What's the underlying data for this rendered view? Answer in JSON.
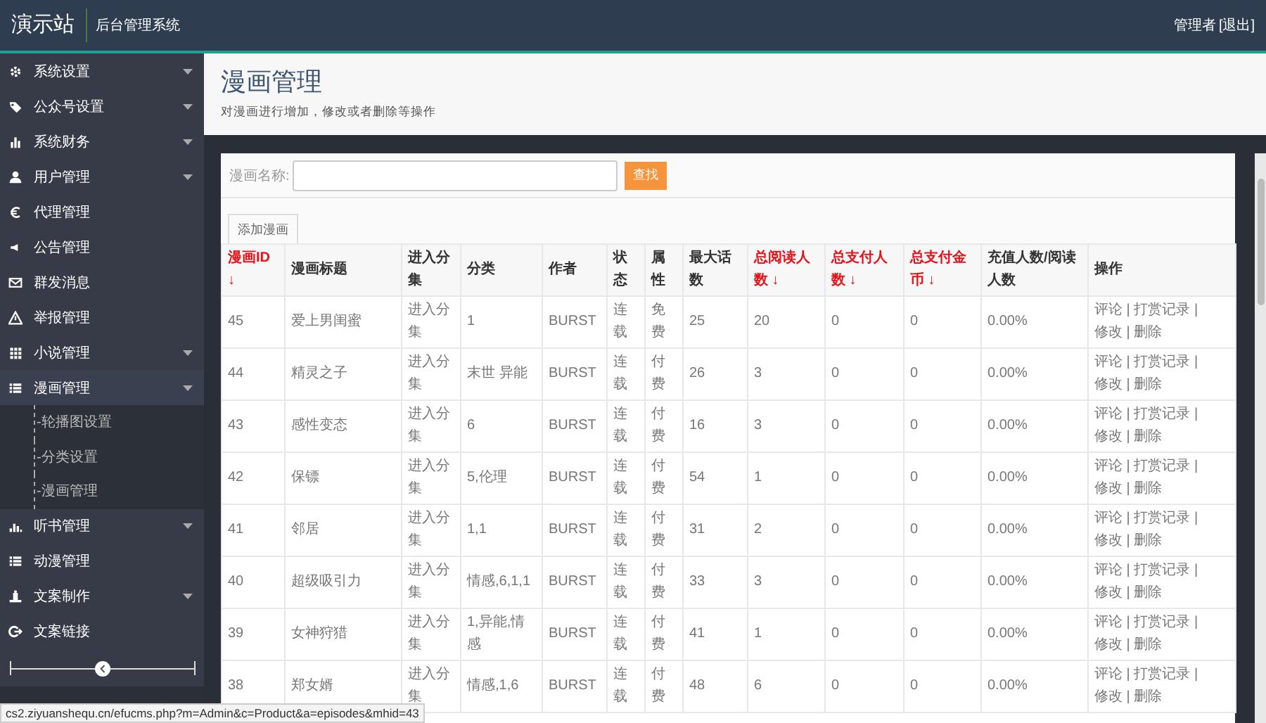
{
  "header": {
    "brand": "演示站",
    "system_name": "后台管理系统",
    "user": "管理者",
    "logout": "[退出]"
  },
  "sidebar": {
    "items": [
      {
        "label": "系统设置",
        "has_submenu": true,
        "expanded": false
      },
      {
        "label": "公众号设置",
        "has_submenu": true,
        "expanded": false
      },
      {
        "label": "系统财务",
        "has_submenu": true,
        "expanded": false
      },
      {
        "label": "用户管理",
        "has_submenu": true,
        "expanded": false
      },
      {
        "label": "代理管理",
        "has_submenu": false
      },
      {
        "label": "公告管理",
        "has_submenu": false
      },
      {
        "label": "群发消息",
        "has_submenu": false
      },
      {
        "label": "举报管理",
        "has_submenu": false
      },
      {
        "label": "小说管理",
        "has_submenu": true,
        "expanded": false
      },
      {
        "label": "漫画管理",
        "has_submenu": true,
        "expanded": true,
        "children": [
          {
            "label": "-轮播图设置"
          },
          {
            "label": "-分类设置"
          },
          {
            "label": "-漫画管理"
          }
        ]
      },
      {
        "label": "听书管理",
        "has_submenu": true,
        "expanded": false
      },
      {
        "label": "动漫管理",
        "has_submenu": false
      },
      {
        "label": "文案制作",
        "has_submenu": true,
        "expanded": false
      },
      {
        "label": "文案链接",
        "has_submenu": false
      }
    ],
    "collapse_slider": {
      "level": 0.5
    }
  },
  "page": {
    "title": "漫画管理",
    "subtitle": "对漫画进行增加，修改或者删除等操作"
  },
  "search": {
    "label": "漫画名称:",
    "button": "查找"
  },
  "add_button": "添加漫画",
  "table": {
    "action_separator": "|",
    "columns": [
      {
        "label": "漫画ID ↓",
        "sortable": true
      },
      {
        "label": "漫画标题",
        "sortable": false
      },
      {
        "label": "进入分集",
        "sortable": false
      },
      {
        "label": "分类",
        "sortable": false
      },
      {
        "label": "作者",
        "sortable": false
      },
      {
        "label": "状态",
        "sortable": false
      },
      {
        "label": "属性",
        "sortable": false
      },
      {
        "label": "最大话数",
        "sortable": false
      },
      {
        "label": "总阅读人数 ↓",
        "sortable": true
      },
      {
        "label": "总支付人数 ↓",
        "sortable": true
      },
      {
        "label": "总支付金币 ↓",
        "sortable": true
      },
      {
        "label": "充值人数/阅读人数",
        "sortable": false
      },
      {
        "label": "操作",
        "sortable": false
      }
    ],
    "rows": [
      {
        "id": "45",
        "title": "爱上男闺蜜",
        "episodes": "进入分集",
        "category": "1",
        "author": "BURST",
        "status": "连载",
        "attribute": "免费",
        "max_episodes": "25",
        "readers": "20",
        "payers": "0",
        "coins": "0",
        "ratio": "0.00%",
        "actions": [
          "评论",
          "打赏记录",
          "修改",
          "删除"
        ]
      },
      {
        "id": "44",
        "title": "精灵之子",
        "episodes": "进入分集",
        "category": "末世 异能",
        "author": "BURST",
        "status": "连载",
        "attribute": "付费",
        "max_episodes": "26",
        "readers": "3",
        "payers": "0",
        "coins": "0",
        "ratio": "0.00%",
        "actions": [
          "评论",
          "打赏记录",
          "修改",
          "删除"
        ]
      },
      {
        "id": "43",
        "title": "感性变态",
        "episodes": "进入分集",
        "category": "6",
        "author": "BURST",
        "status": "连载",
        "attribute": "付费",
        "max_episodes": "16",
        "readers": "3",
        "payers": "0",
        "coins": "0",
        "ratio": "0.00%",
        "actions": [
          "评论",
          "打赏记录",
          "修改",
          "删除"
        ]
      },
      {
        "id": "42",
        "title": "保镖",
        "episodes": "进入分集",
        "category": "5,伦理",
        "author": "BURST",
        "status": "连载",
        "attribute": "付费",
        "max_episodes": "54",
        "readers": "1",
        "payers": "0",
        "coins": "0",
        "ratio": "0.00%",
        "actions": [
          "评论",
          "打赏记录",
          "修改",
          "删除"
        ]
      },
      {
        "id": "41",
        "title": "邻居",
        "episodes": "进入分集",
        "category": "1,1",
        "author": "BURST",
        "status": "连载",
        "attribute": "付费",
        "max_episodes": "31",
        "readers": "2",
        "payers": "0",
        "coins": "0",
        "ratio": "0.00%",
        "actions": [
          "评论",
          "打赏记录",
          "修改",
          "删除"
        ]
      },
      {
        "id": "40",
        "title": "超级吸引力",
        "episodes": "进入分集",
        "category": "情感,6,1,1",
        "author": "BURST",
        "status": "连载",
        "attribute": "付费",
        "max_episodes": "33",
        "readers": "3",
        "payers": "0",
        "coins": "0",
        "ratio": "0.00%",
        "actions": [
          "评论",
          "打赏记录",
          "修改",
          "删除"
        ]
      },
      {
        "id": "39",
        "title": "女神狩猎",
        "episodes": "进入分集",
        "category": "1,异能,情感",
        "author": "BURST",
        "status": "连载",
        "attribute": "付费",
        "max_episodes": "41",
        "readers": "1",
        "payers": "0",
        "coins": "0",
        "ratio": "0.00%",
        "actions": [
          "评论",
          "打赏记录",
          "修改",
          "删除"
        ]
      },
      {
        "id": "38",
        "title": "郑女婿",
        "episodes": "进入分集",
        "category": "情感,1,6",
        "author": "BURST",
        "status": "连载",
        "attribute": "付费",
        "max_episodes": "48",
        "readers": "6",
        "payers": "0",
        "coins": "0",
        "ratio": "0.00%",
        "actions": [
          "评论",
          "打赏记录",
          "修改",
          "删除"
        ]
      }
    ]
  },
  "status_url": "cs2.ziyuanshequ.cn/efucms.php?m=Admin&c=Product&a=episodes&mhid=43"
}
